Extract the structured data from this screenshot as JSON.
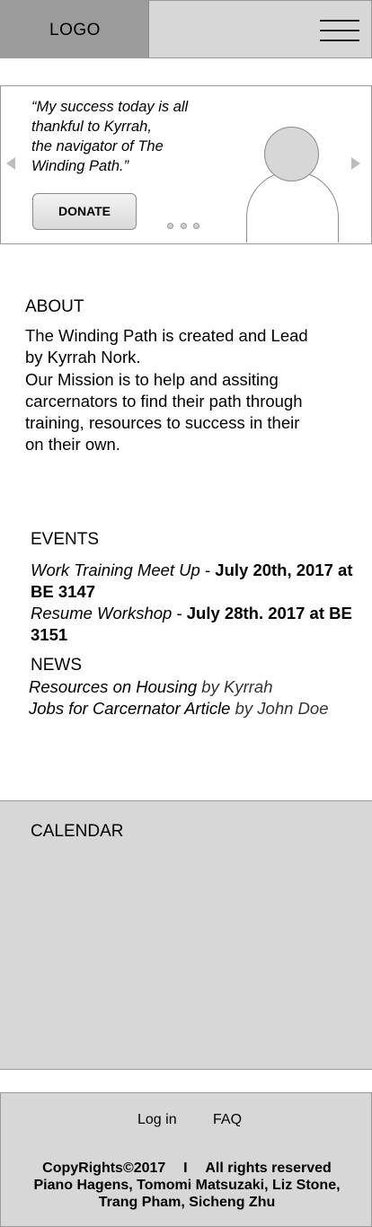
{
  "header": {
    "logo": "LOGO",
    "menu_icon": "hamburger-menu-icon"
  },
  "hero": {
    "quote_lines": [
      "“My success today is all",
      "thankful to Kyrrah,",
      "the navigator of The",
      "Winding Path.”"
    ],
    "donate_label": "DONATE",
    "prev_icon": "triangle-left-icon",
    "next_icon": "triangle-right-icon",
    "carousel_dots": 3,
    "avatar_icon": "person-placeholder-icon"
  },
  "about": {
    "title": "ABOUT",
    "body_lines": [
      "The Winding Path is created and Lead",
      "by Kyrrah Nork.",
      "Our Mission is to help and assiting",
      "carcernators to find their path through",
      "training, resources to success in their",
      "on their own."
    ]
  },
  "events": {
    "title": "EVENTS",
    "items": [
      {
        "name": "Work Training Meet Up",
        "sep": " - ",
        "date": "July 20th, 2017 at BE 3147"
      },
      {
        "name": "Resume Workshop",
        "sep": " - ",
        "date": "July 28th. 2017 at BE 3151"
      }
    ]
  },
  "news": {
    "title": "NEWS",
    "items": [
      {
        "title": "Resources on Housing",
        "byline": " by Kyrrah"
      },
      {
        "title": "Jobs for Carcernator Article",
        "byline": " by John Doe"
      }
    ]
  },
  "calendar": {
    "title": "CALENDAR"
  },
  "footer": {
    "login": "Log in",
    "faq": "FAQ",
    "copyright": "CopyRights©2017",
    "separator": "I",
    "rights": "All rights reserved",
    "credits_line1": "Piano Hagens, Tomomi Matsuzaki, Liz Stone,",
    "credits_line2": "Trang Pham, Sicheng Zhu"
  }
}
